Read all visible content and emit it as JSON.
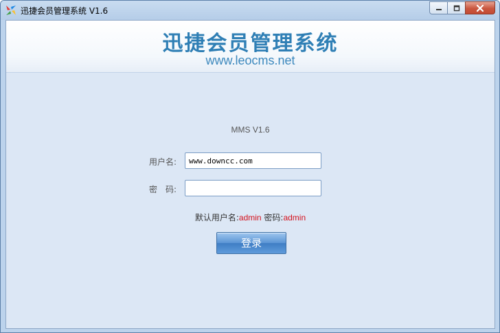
{
  "window": {
    "title": "迅捷会员管理系统 V1.6",
    "icon": "app-logo-icon",
    "controls": {
      "minimize": "minimize-icon",
      "maximize": "maximize-icon",
      "close": "close-icon"
    }
  },
  "header": {
    "title": "迅捷会员管理系统",
    "url": "www.leocms.net"
  },
  "form": {
    "version": "MMS V1.6",
    "username_label": "用户名:",
    "username_value": "www.downcc.com",
    "password_label": "密　码:",
    "password_value": "",
    "hint_prefix": "默认用户名:",
    "hint_user": "admin",
    "hint_middle": " 密码:",
    "hint_pass": "admin",
    "login_label": "登录"
  },
  "colors": {
    "brand": "#2f7fb5",
    "hint_red": "#d4101b",
    "background": "#dce7f5"
  }
}
